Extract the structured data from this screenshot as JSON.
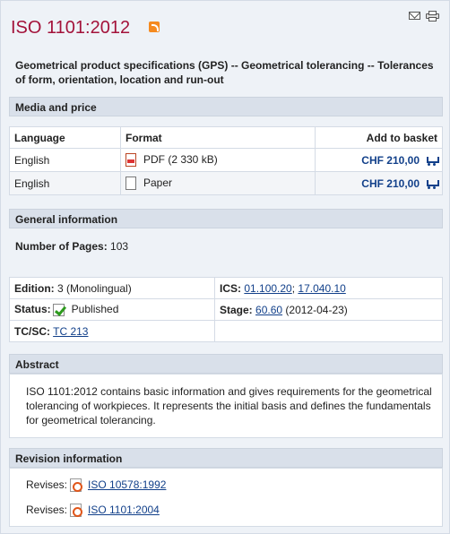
{
  "header": {
    "title": "ISO 1101:2012",
    "subtitle": "Geometrical product specifications (GPS) -- Geometrical tolerancing -- Tolerances of form, orientation, location and run-out",
    "icons": [
      "rss-icon",
      "mail-icon",
      "print-icon"
    ]
  },
  "media": {
    "heading": "Media and price",
    "col_language": "Language",
    "col_format": "Format",
    "col_basket": "Add to basket",
    "rows": [
      {
        "language": "English",
        "format": "PDF (2 330 kB)",
        "price": "CHF 210,00",
        "icon": "pdf-icon"
      },
      {
        "language": "English",
        "format": "Paper",
        "price": "CHF 210,00",
        "icon": "paper-icon"
      }
    ]
  },
  "general": {
    "heading": "General information",
    "pages_label": "Number of Pages:",
    "pages_value": "103"
  },
  "info": {
    "edition_label": "Edition:",
    "edition_value": "3 (Monolingual)",
    "ics_label": "ICS:",
    "ics_1": "01.100.20",
    "ics_sep": ";",
    "ics_2": "17.040.10",
    "status_label": "Status:",
    "status_value": "Published",
    "stage_label": "Stage:",
    "stage_link": "60.60",
    "stage_date": "(2012-04-23)",
    "tcsc_label": "TC/SC:",
    "tcsc_link": "TC 213"
  },
  "abstract": {
    "heading": "Abstract",
    "text": "ISO 1101:2012 contains basic information and gives requirements for the geometrical tolerancing of workpieces. It represents the initial basis and defines the fundamentals for geometrical tolerancing."
  },
  "revision": {
    "heading": "Revision information",
    "items": [
      {
        "label": "Revises:",
        "link": "ISO 10578:1992"
      },
      {
        "label": "Revises:",
        "link": "ISO 1101:2004"
      }
    ]
  },
  "colors": {
    "title": "#a3123a",
    "link": "#12408a",
    "section_bg": "#d9e0ea"
  }
}
